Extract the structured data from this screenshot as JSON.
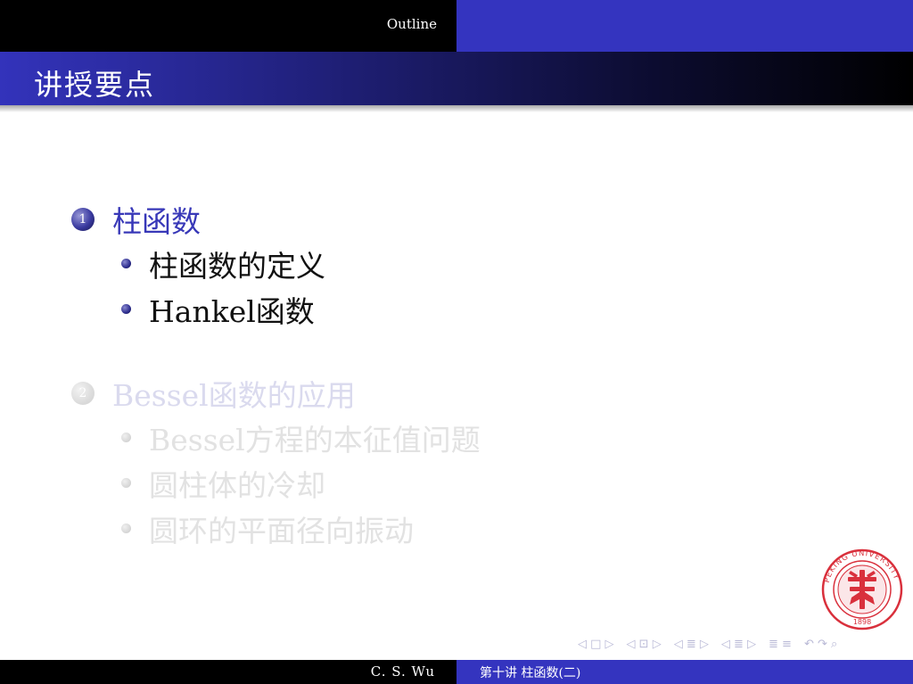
{
  "header": {
    "outline_label": "Outline"
  },
  "frame": {
    "title": "讲授要点"
  },
  "toc": {
    "sections": [
      {
        "number": "1",
        "title": "柱函数",
        "state": "active",
        "subsections": [
          "柱函数的定义",
          "Hankel函数"
        ]
      },
      {
        "number": "2",
        "title": "Bessel函数的应用",
        "state": "inactive",
        "subsections": [
          "Bessel方程的本征值问题",
          "圆柱体的冷却",
          "圆环的平面径向振动"
        ]
      }
    ]
  },
  "logo": {
    "icon": "peking-university-seal-icon",
    "ring_text": "PEKING UNIVERSITY",
    "year": "1898",
    "color": "#d9303c"
  },
  "navigation": {
    "frame": "◁ □ ▷",
    "subsection": "◁ ⊡ ▷",
    "section": "◁ ≣ ▷",
    "subsubsection": "◁ ≣ ▷",
    "align": "≣ ≡",
    "search": "↶ ↷ ⌕"
  },
  "footer": {
    "author": "C. S. Wu",
    "title": "第十讲  柱函数(二)"
  },
  "colors": {
    "beamer_blue": "#3434bf",
    "black": "#000000",
    "title_text": "#ffffff",
    "section_active": "#3838b8"
  }
}
